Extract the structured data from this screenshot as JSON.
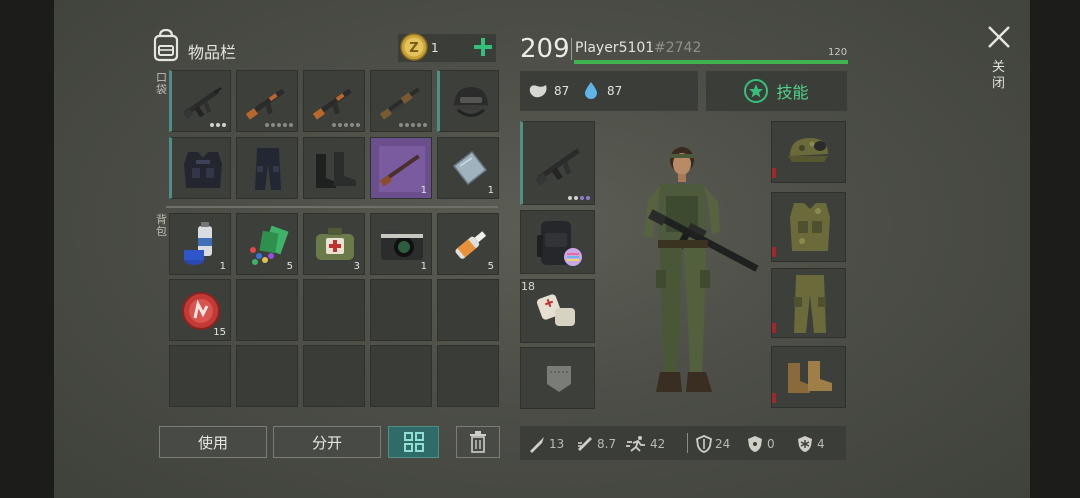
{
  "inventory": {
    "title": "物品栏",
    "coins": "1",
    "pocket_label": "口袋",
    "backpack_label": "背包",
    "items": {
      "shotgun_qty": "1",
      "plate_qty": "1",
      "spray_qty": "1",
      "pills_qty": "5",
      "medkit_qty": "3",
      "camera_qty": "1",
      "glue_qty": "5",
      "cap_qty": "15"
    }
  },
  "actions": {
    "use": "使用",
    "split": "分开"
  },
  "player": {
    "level": "209",
    "name": "Player5101",
    "tag": "#2742",
    "health": "120",
    "food": "87",
    "water": "87",
    "skills_label": "技能",
    "bandage_qty": "18"
  },
  "stats": {
    "melee": "13",
    "ranged": "8.7",
    "speed": "42",
    "armor": "24",
    "radiation": "0",
    "cold": "4"
  },
  "close_label": "关闭",
  "colors": {
    "accent_teal": "#4f8f86",
    "health_green": "#3fb34f",
    "plus_green": "#35c07a",
    "durability_red": "#a1282a"
  }
}
